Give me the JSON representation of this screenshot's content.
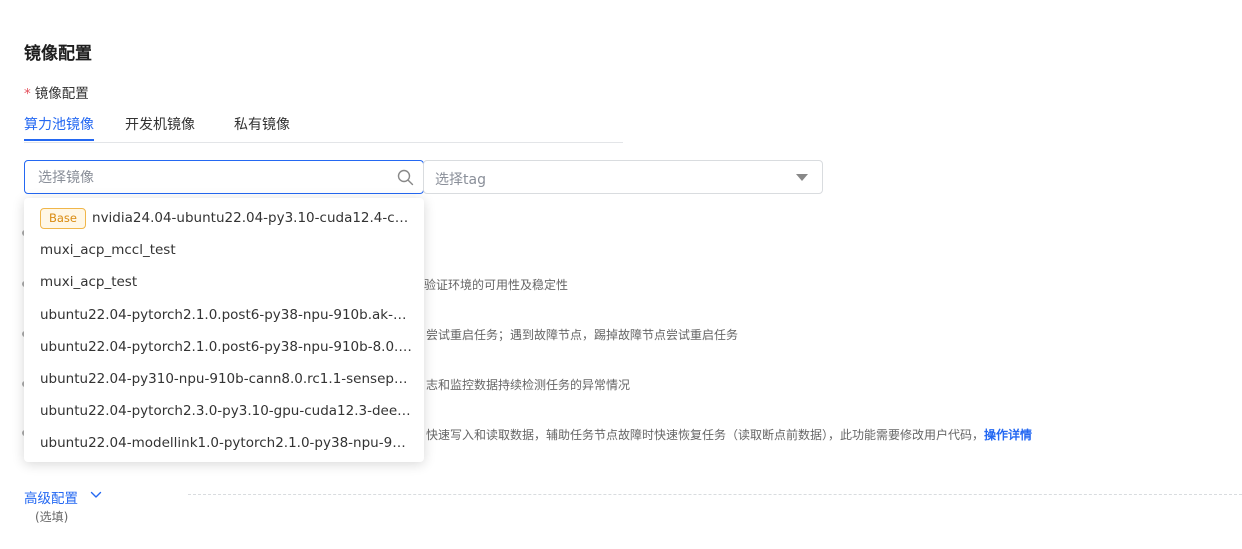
{
  "section": {
    "title": "镜像配置"
  },
  "field": {
    "required_mark": "*",
    "label": "镜像配置"
  },
  "tabs": [
    {
      "label": "算力池镜像",
      "active": true
    },
    {
      "label": "开发机镜像",
      "active": false
    },
    {
      "label": "私有镜像",
      "active": false
    }
  ],
  "search": {
    "placeholder": "选择镜像",
    "value": ""
  },
  "tag_select": {
    "placeholder": "选择tag"
  },
  "dropdown": {
    "options": [
      {
        "badge": "Base",
        "label": "nvidia24.04-ubuntu22.04-py3.10-cuda12.4-cudnn..."
      },
      {
        "label": "muxi_acp_mccl_test"
      },
      {
        "label": "muxi_acp_test"
      },
      {
        "label": "ubuntu22.04-pytorch2.1.0.post6-py38-npu-910b.ak-8.0.rc..."
      },
      {
        "label": "ubuntu22.04-pytorch2.1.0.post6-py38-npu-910b-8.0.rc2-..."
      },
      {
        "label": "ubuntu22.04-py310-npu-910b-cann8.0.rc1.1-senseparrots..."
      },
      {
        "label": "ubuntu22.04-pytorch2.3.0-py3.10-gpu-cuda12.3-deepspe..."
      },
      {
        "label": "ubuntu22.04-modellink1.0-pytorch2.1.0-py38-npu-910b-..."
      }
    ]
  },
  "background_text": {
    "line1": "验证环境的可用性及稳定性",
    "line2": "尝试重启任务；遇到故障节点，踢掉故障节点尝试重启任务",
    "line3": "志和监控数据持续检测任务的异常情况",
    "line4": "快速写入和读取数据，辅助任务节点故障时快速恢复任务（读取断点前数据），此功能需要修改用户代码，",
    "line4_link": "操作详情"
  },
  "advanced": {
    "label": "高级配置",
    "note": "(选填)"
  },
  "colors": {
    "accent": "#2468f2",
    "badge_text": "#d98b11",
    "badge_border": "#f0b64a",
    "required": "#e34d59"
  },
  "icons": {
    "search": "search-icon",
    "dropdown_arrow": "caret-down-icon",
    "expand": "chevron-down-icon"
  }
}
